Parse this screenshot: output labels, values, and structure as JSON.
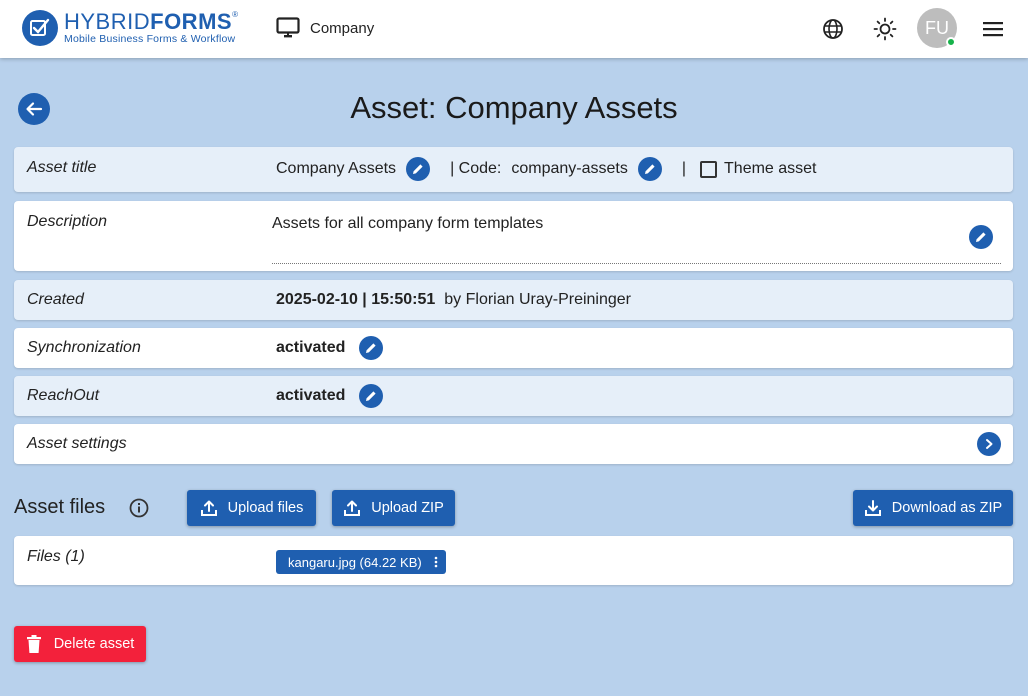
{
  "header": {
    "logo_name_light": "HYBRID",
    "logo_name_bold": "FORMS",
    "logo_reg": "®",
    "logo_tagline": "Mobile Business Forms & Workflow",
    "company_label": "Company",
    "avatar_initials": "FU"
  },
  "page": {
    "title": "Asset: Company Assets"
  },
  "fields": {
    "asset_title": {
      "label": "Asset title",
      "value": "Company Assets",
      "code_label": "| Code:",
      "code_value": "company-assets",
      "theme_sep": "|",
      "theme_label": "Theme asset"
    },
    "description": {
      "label": "Description",
      "value": "Assets for all company form templates"
    },
    "created": {
      "label": "Created",
      "datetime": "2025-02-10 | 15:50:51",
      "by": "by Florian Uray-Preininger"
    },
    "synchronization": {
      "label": "Synchronization",
      "value": "activated"
    },
    "reachout": {
      "label": "ReachOut",
      "value": "activated"
    },
    "asset_settings": {
      "label": "Asset settings"
    }
  },
  "files": {
    "section_title": "Asset files",
    "upload_files_label": "Upload files",
    "upload_zip_label": "Upload ZIP",
    "download_zip_label": "Download as ZIP",
    "list_label": "Files (1)",
    "items": [
      {
        "name": "kangaru.jpg (64.22 KB)"
      }
    ]
  },
  "actions": {
    "delete_label": "Delete asset"
  },
  "colors": {
    "primary": "#1f5fb0",
    "background": "#b8d1ec",
    "row_alt": "#e6eff9",
    "danger": "#f3213b",
    "online": "#16b24a"
  }
}
